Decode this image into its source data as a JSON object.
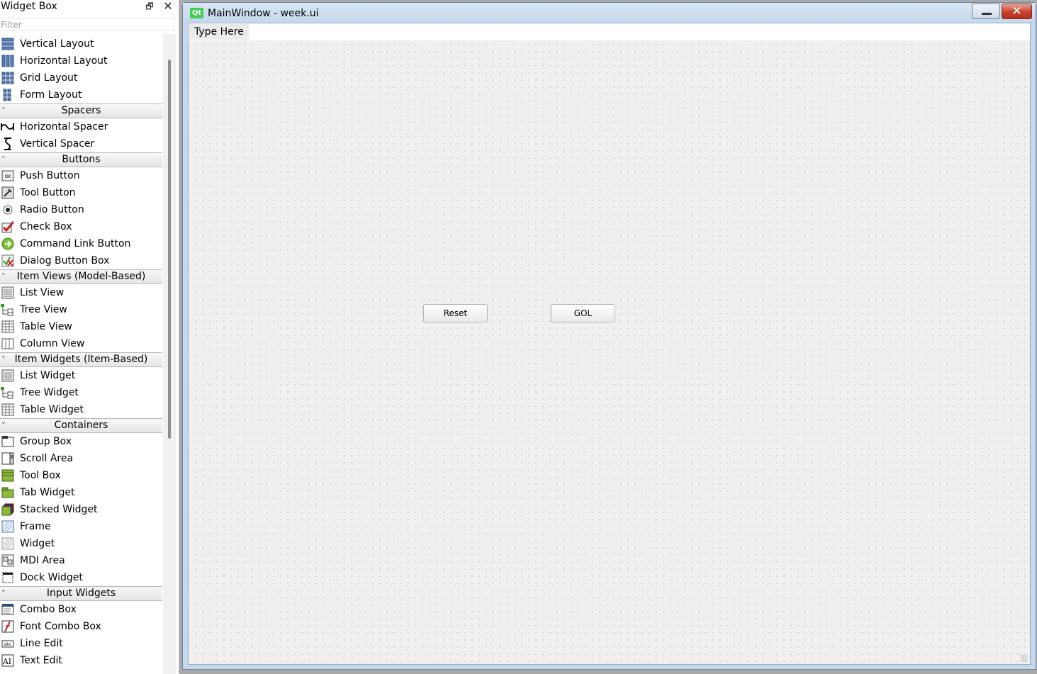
{
  "widget_box": {
    "title": "Widget Box",
    "filter_placeholder": "Filter",
    "sections": [
      {
        "category": null,
        "items": [
          {
            "label": "Vertical Layout",
            "icon": "vertical-layout-icon"
          },
          {
            "label": "Horizontal Layout",
            "icon": "horizontal-layout-icon"
          },
          {
            "label": "Grid Layout",
            "icon": "grid-layout-icon"
          },
          {
            "label": "Form Layout",
            "icon": "form-layout-icon"
          }
        ]
      },
      {
        "category": "Spacers",
        "items": [
          {
            "label": "Horizontal Spacer",
            "icon": "horizontal-spacer-icon"
          },
          {
            "label": "Vertical Spacer",
            "icon": "vertical-spacer-icon"
          }
        ]
      },
      {
        "category": "Buttons",
        "items": [
          {
            "label": "Push Button",
            "icon": "push-button-icon"
          },
          {
            "label": "Tool Button",
            "icon": "tool-button-icon"
          },
          {
            "label": "Radio Button",
            "icon": "radio-button-icon"
          },
          {
            "label": "Check Box",
            "icon": "check-box-icon"
          },
          {
            "label": "Command Link Button",
            "icon": "command-link-icon"
          },
          {
            "label": "Dialog Button Box",
            "icon": "dialog-button-box-icon"
          }
        ]
      },
      {
        "category": "Item Views (Model-Based)",
        "items": [
          {
            "label": "List View",
            "icon": "list-view-icon"
          },
          {
            "label": "Tree View",
            "icon": "tree-view-icon"
          },
          {
            "label": "Table View",
            "icon": "table-view-icon"
          },
          {
            "label": "Column View",
            "icon": "column-view-icon"
          }
        ]
      },
      {
        "category": "Item Widgets (Item-Based)",
        "items": [
          {
            "label": "List Widget",
            "icon": "list-widget-icon"
          },
          {
            "label": "Tree Widget",
            "icon": "tree-widget-icon"
          },
          {
            "label": "Table Widget",
            "icon": "table-widget-icon"
          }
        ]
      },
      {
        "category": "Containers",
        "items": [
          {
            "label": "Group Box",
            "icon": "group-box-icon"
          },
          {
            "label": "Scroll Area",
            "icon": "scroll-area-icon"
          },
          {
            "label": "Tool Box",
            "icon": "tool-box-icon"
          },
          {
            "label": "Tab Widget",
            "icon": "tab-widget-icon"
          },
          {
            "label": "Stacked Widget",
            "icon": "stacked-widget-icon"
          },
          {
            "label": "Frame",
            "icon": "frame-icon"
          },
          {
            "label": "Widget",
            "icon": "widget-icon"
          },
          {
            "label": "MDI Area",
            "icon": "mdi-area-icon"
          },
          {
            "label": "Dock Widget",
            "icon": "dock-widget-icon"
          }
        ]
      },
      {
        "category": "Input Widgets",
        "items": [
          {
            "label": "Combo Box",
            "icon": "combo-box-icon"
          },
          {
            "label": "Font Combo Box",
            "icon": "font-combo-box-icon"
          },
          {
            "label": "Line Edit",
            "icon": "line-edit-icon"
          },
          {
            "label": "Text Edit",
            "icon": "text-edit-icon"
          }
        ]
      }
    ]
  },
  "form_window": {
    "logo_text": "Qt",
    "title": "MainWindow - week.ui",
    "close_glyph": "✕",
    "menubar": {
      "placeholder": "Type Here"
    },
    "buttons": [
      {
        "label": "Reset"
      },
      {
        "label": "GOL"
      }
    ]
  },
  "colors": {
    "titlebar": "#c4d7ec",
    "close_button": "#c4412c",
    "qt_logo": "#41cd52",
    "canvas": "#f0f0f0"
  }
}
